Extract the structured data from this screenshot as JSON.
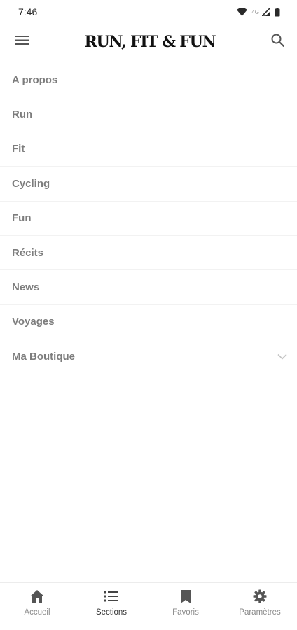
{
  "status_bar": {
    "time": "7:46",
    "network_label": "4G",
    "icons": [
      "wifi-icon",
      "signal-icon",
      "battery-icon"
    ]
  },
  "app_bar": {
    "title": "RUN, FIT & FUN",
    "left_icon": "menu-icon",
    "right_icon": "search-icon"
  },
  "menu": {
    "items": [
      {
        "label": "A propos"
      },
      {
        "label": "Run"
      },
      {
        "label": "Fit"
      },
      {
        "label": "Cycling"
      },
      {
        "label": "Fun"
      },
      {
        "label": "Récits"
      },
      {
        "label": "News"
      },
      {
        "label": "Voyages"
      },
      {
        "label": "Ma Boutique",
        "expandable": true
      }
    ]
  },
  "bottom_nav": {
    "active": "Sections",
    "items": [
      {
        "label": "Accueil",
        "icon": "home-icon"
      },
      {
        "label": "Sections",
        "icon": "list-icon"
      },
      {
        "label": "Favoris",
        "icon": "bookmark-icon"
      },
      {
        "label": "Paramètres",
        "icon": "gear-icon"
      }
    ]
  },
  "colors": {
    "menu_text": "#7d7d7d",
    "icon_dark": "#555555",
    "nav_label": "#8a8a8a",
    "divider": "#f2f2f2"
  }
}
